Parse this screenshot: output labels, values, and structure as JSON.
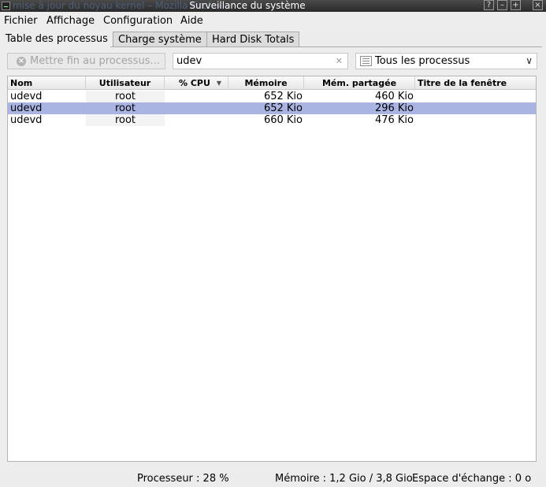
{
  "window": {
    "title": "Surveillance du système",
    "ghost_text": "mise à jour du noyau kernel – Mozilla Firefox"
  },
  "menu": [
    "Fichier",
    "Affichage",
    "Configuration",
    "Aide"
  ],
  "tabs": [
    {
      "label": "Table des processus",
      "active": true
    },
    {
      "label": "Charge système",
      "active": false
    },
    {
      "label": "Hard Disk Totals",
      "active": false
    }
  ],
  "toolbar": {
    "kill_label": "Mettre fin au processus...",
    "search_value": "udev",
    "filter_value": "Tous les processus"
  },
  "table": {
    "columns": [
      "Nom",
      "Utilisateur",
      "% CPU",
      "Mémoire",
      "Mém. partagée",
      "Titre de la fenêtre"
    ],
    "rows": [
      {
        "nom": "udevd",
        "user": "root",
        "cpu": "",
        "mem": "652 Kio",
        "shared": "460 Kio",
        "title": ""
      },
      {
        "nom": "udevd",
        "user": "root",
        "cpu": "",
        "mem": "652 Kio",
        "shared": "296 Kio",
        "title": ""
      },
      {
        "nom": "udevd",
        "user": "root",
        "cpu": "",
        "mem": "660 Kio",
        "shared": "476 Kio",
        "title": ""
      }
    ],
    "selected_row": 1
  },
  "status": {
    "cpu": "Processeur : 28 %",
    "memory": "Mémoire : 1,2 Gio / 3,8 Gio",
    "swap": "Espace d'échange : 0 o"
  }
}
